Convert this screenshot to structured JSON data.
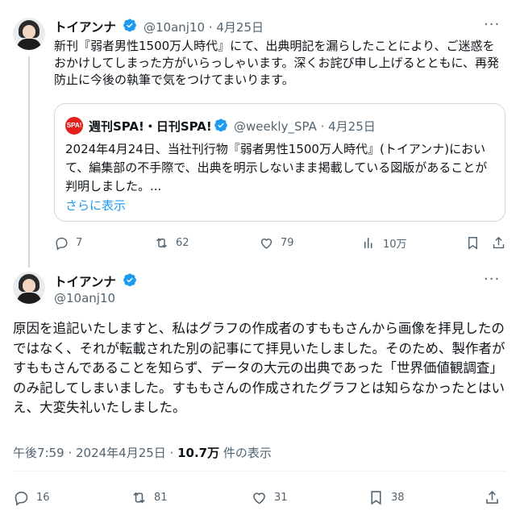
{
  "tweet1": {
    "author_name": "トイアンナ",
    "handle": "@10anj10",
    "date": "4月25日",
    "text": "新刊『弱者男性1500万人時代』にて、出典明記を漏らしたことにより、ご迷惑をおかけしてしまった方がいらっしゃいます。深くお詫び申し上げるとともに、再発防止に今後の執筆で気をつけてまいります。",
    "quote": {
      "logo_text": "SPA!",
      "author_name": "週刊SPA!・日刊SPA!",
      "handle": "@weekly_SPA",
      "date": "4月25日",
      "text": "2024年4月24日、当社刊行物『弱者男性1500万人時代』(トイアンナ)において、編集部の不手際で、出典を明示しないまま掲載している図版があることが判明しました。...",
      "show_more": "さらに表示"
    },
    "actions": {
      "replies": "7",
      "retweets": "62",
      "likes": "79",
      "views": "10万"
    }
  },
  "tweet2": {
    "author_name": "トイアンナ",
    "handle": "@10anj10",
    "text": "原因を追記いたしますと、私はグラフの作成者のすももさんから画像を拝見したのではなく、それが転載された別の記事にて拝見いたしました。そのため、製作者がすももさんであることを知らず、データの大元の出典であった「世界価値観調査」のみ記してしまいました。すももさんの作成されたグラフとは知らなかったとはいえ、大変失礼いたしました。",
    "time": "午後7:59 · 2024年4月25日 · ",
    "views_count": "10.7万",
    "views_label": " 件の表示",
    "actions": {
      "replies": "16",
      "retweets": "81",
      "likes": "31",
      "bookmarks": "38"
    }
  },
  "colors": {
    "verified": "#1d9bf0",
    "secondary_text": "#536471",
    "link": "#1d9bf0",
    "border": "#cfd9de"
  }
}
